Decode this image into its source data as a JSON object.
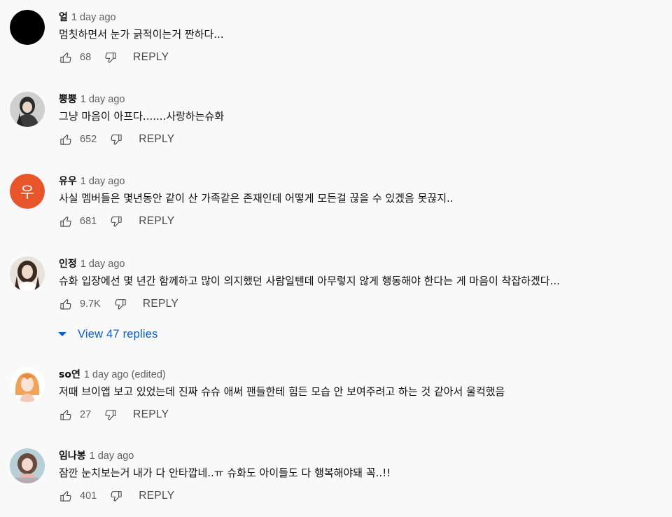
{
  "theme": {
    "reply_label": "REPLY",
    "link_color": "#065fd4",
    "icon_color": "#0f0f0f"
  },
  "comments": [
    {
      "author": "얼",
      "time": "1 day ago",
      "text": "멈칫하면서 눈가 긁적이는거 짠하다...",
      "likes": "68",
      "avatar": {
        "type": "solid",
        "color": "#000000"
      }
    },
    {
      "author": "뿡뿡",
      "time": "1 day ago",
      "text": "그냥 마음이 아프다.......사랑하는슈화",
      "likes": "652",
      "avatar": {
        "type": "photo",
        "icon": "person-photo"
      }
    },
    {
      "author": "유우",
      "time": "1 day ago",
      "text": "사실 멤버들은 몇년동안 같이 산 가족같은 존재인데 어떻게 모든걸 끊을 수 있겠음 못끊지..",
      "likes": "681",
      "avatar": {
        "type": "letter",
        "letter": "우",
        "color": "#e8552b"
      }
    },
    {
      "author": "인정",
      "time": "1 day ago",
      "text": "슈화 입장에선 몇 년간 함께하고 많이 의지했던 사람일텐데 아무렇지 않게 행동해야 한다는 게 마음이 착잡하겠다...",
      "likes": "9.7K",
      "avatar": {
        "type": "photo",
        "icon": "person-photo"
      },
      "replies_label": "View 47 replies"
    },
    {
      "author": "so연",
      "time": "1 day ago (edited)",
      "text": "저때 브이앱 보고 있었는데 진짜 슈슈 애써 팬들한테 힘든 모습 안 보여주려고 하는 것 같아서 울컥했음",
      "likes": "27",
      "avatar": {
        "type": "photo",
        "icon": "person-photo"
      }
    },
    {
      "author": "임나봉",
      "time": "1 day ago",
      "text": "잠깐 눈치보는거 내가 다 안타깝네..ㅠ 슈화도 아이들도 다 행복해야돼 꼭..!!",
      "likes": "401",
      "avatar": {
        "type": "photo",
        "icon": "person-photo"
      }
    }
  ]
}
